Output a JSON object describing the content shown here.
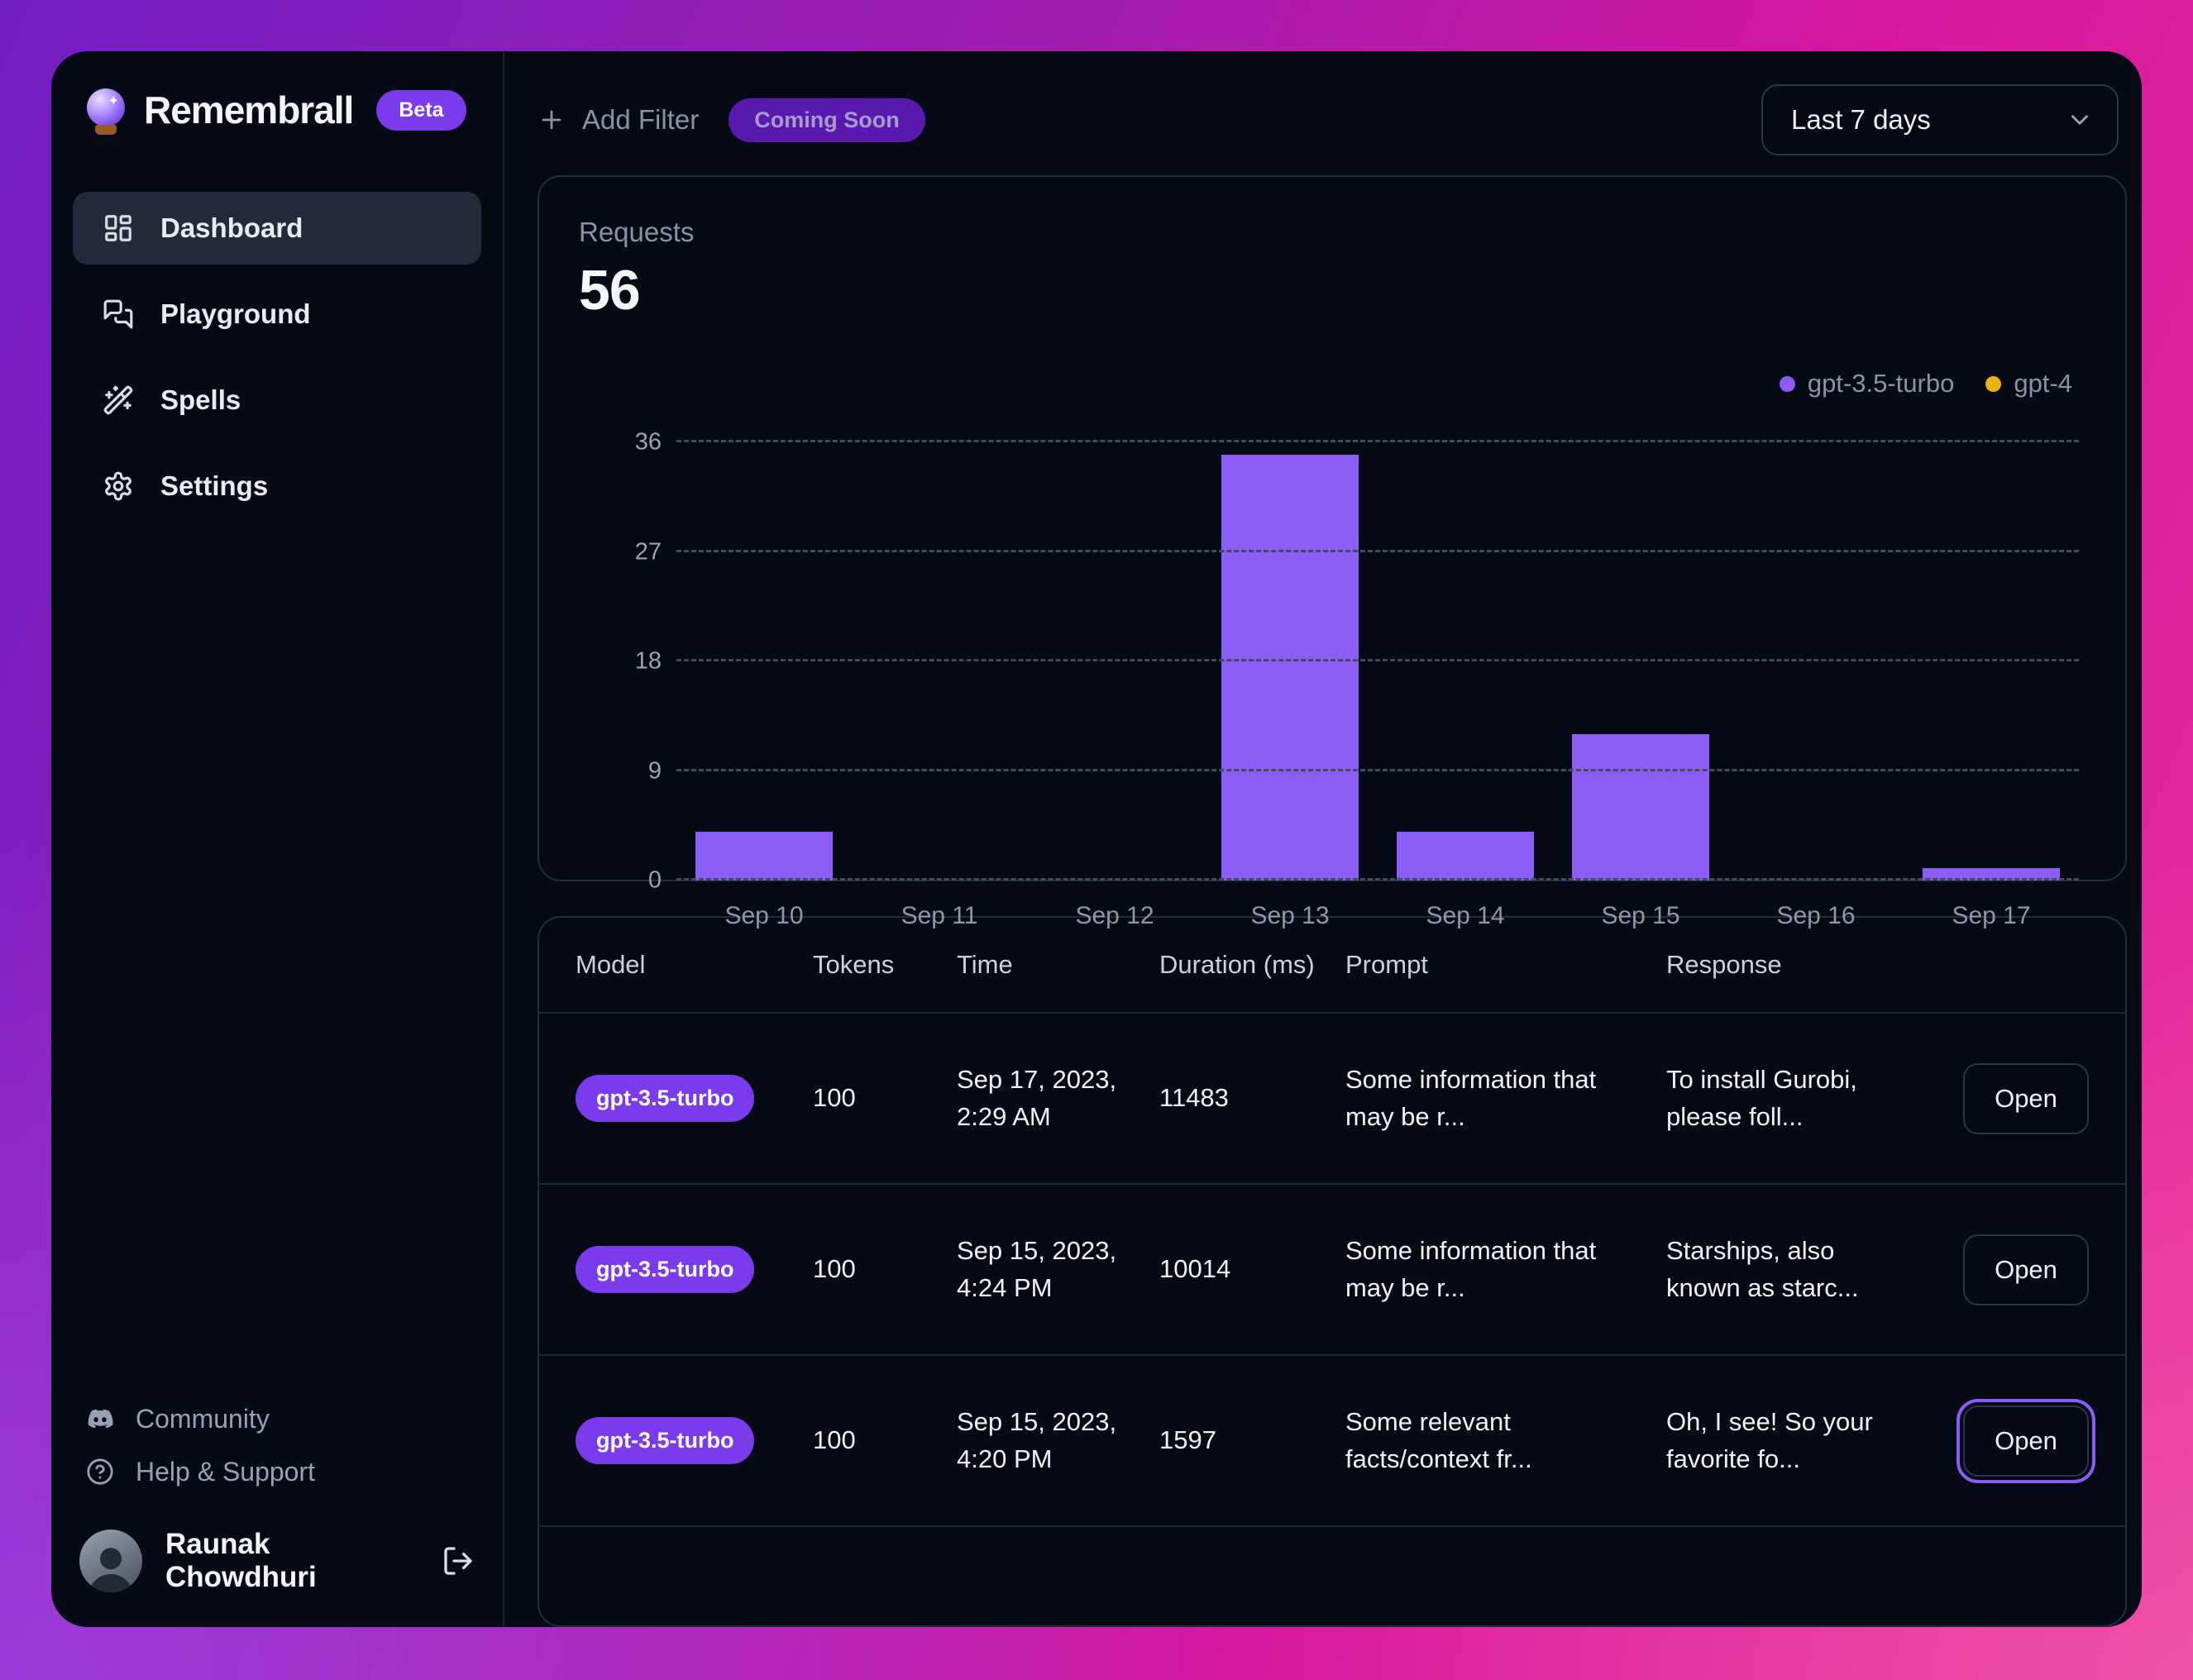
{
  "app": {
    "name": "Remembrall",
    "badge": "Beta",
    "logo_icon": "crystal-ball"
  },
  "sidebar": {
    "nav": [
      {
        "label": "Dashboard",
        "icon": "layout-dashboard",
        "active": true
      },
      {
        "label": "Playground",
        "icon": "messages-square",
        "active": false
      },
      {
        "label": "Spells",
        "icon": "wand-sparkles",
        "active": false
      },
      {
        "label": "Settings",
        "icon": "gear",
        "active": false
      }
    ],
    "footer_nav": [
      {
        "label": "Community",
        "icon": "discord"
      },
      {
        "label": "Help & Support",
        "icon": "help-circle"
      }
    ],
    "user": {
      "name": "Raunak Chowdhuri",
      "logout_icon": "log-out"
    }
  },
  "topbar": {
    "add_filter_label": "Add Filter",
    "coming_soon_badge": "Coming Soon",
    "range_selector": "Last 7 days"
  },
  "stats": {
    "requests_label": "Requests",
    "requests_value": "56"
  },
  "chart_data": {
    "type": "bar",
    "categories": [
      "Sep 10",
      "Sep 11",
      "Sep 12",
      "Sep 13",
      "Sep 14",
      "Sep 15",
      "Sep 16",
      "Sep 17"
    ],
    "series": [
      {
        "name": "gpt-3.5-turbo",
        "color": "#8b5cf6",
        "values": [
          4,
          0,
          0,
          35,
          4,
          12,
          0,
          1
        ]
      },
      {
        "name": "gpt-4",
        "color": "#eab308",
        "values": [
          0,
          0,
          0,
          0,
          0,
          0,
          0,
          0
        ]
      }
    ],
    "title": "Requests",
    "total": 56,
    "xlabel": "",
    "ylabel": "",
    "ylim": [
      0,
      36
    ],
    "yticks": [
      0,
      9,
      18,
      27,
      36
    ],
    "grid": "horizontal-dashed",
    "legend_position": "top-right"
  },
  "table": {
    "headers": [
      "Model",
      "Tokens",
      "Time",
      "Duration (ms)",
      "Prompt",
      "Response"
    ],
    "open_label": "Open",
    "rows": [
      {
        "model": "gpt-3.5-turbo",
        "tokens": "100",
        "time": "Sep 17, 2023, 2:29 AM",
        "duration_ms": "11483",
        "prompt": "Some information that may be r...",
        "response": "To install Gurobi, please foll...",
        "open_focused": false
      },
      {
        "model": "gpt-3.5-turbo",
        "tokens": "100",
        "time": "Sep 15, 2023, 4:24 PM",
        "duration_ms": "10014",
        "prompt": "Some information that may be r...",
        "response": "Starships, also known as starc...",
        "open_focused": false
      },
      {
        "model": "gpt-3.5-turbo",
        "tokens": "100",
        "time": "Sep 15, 2023, 4:20 PM",
        "duration_ms": "1597",
        "prompt": "Some relevant facts/context fr...",
        "response": "Oh, I see! So your favorite fo...",
        "open_focused": true
      }
    ]
  },
  "colors": {
    "bar_purple": "#8b5cf6",
    "gpt4_yellow": "#eab308",
    "badge_purple": "#7c3aed",
    "coming_soon_purple": "#5a19ae",
    "panel_bg": "#060a14"
  }
}
